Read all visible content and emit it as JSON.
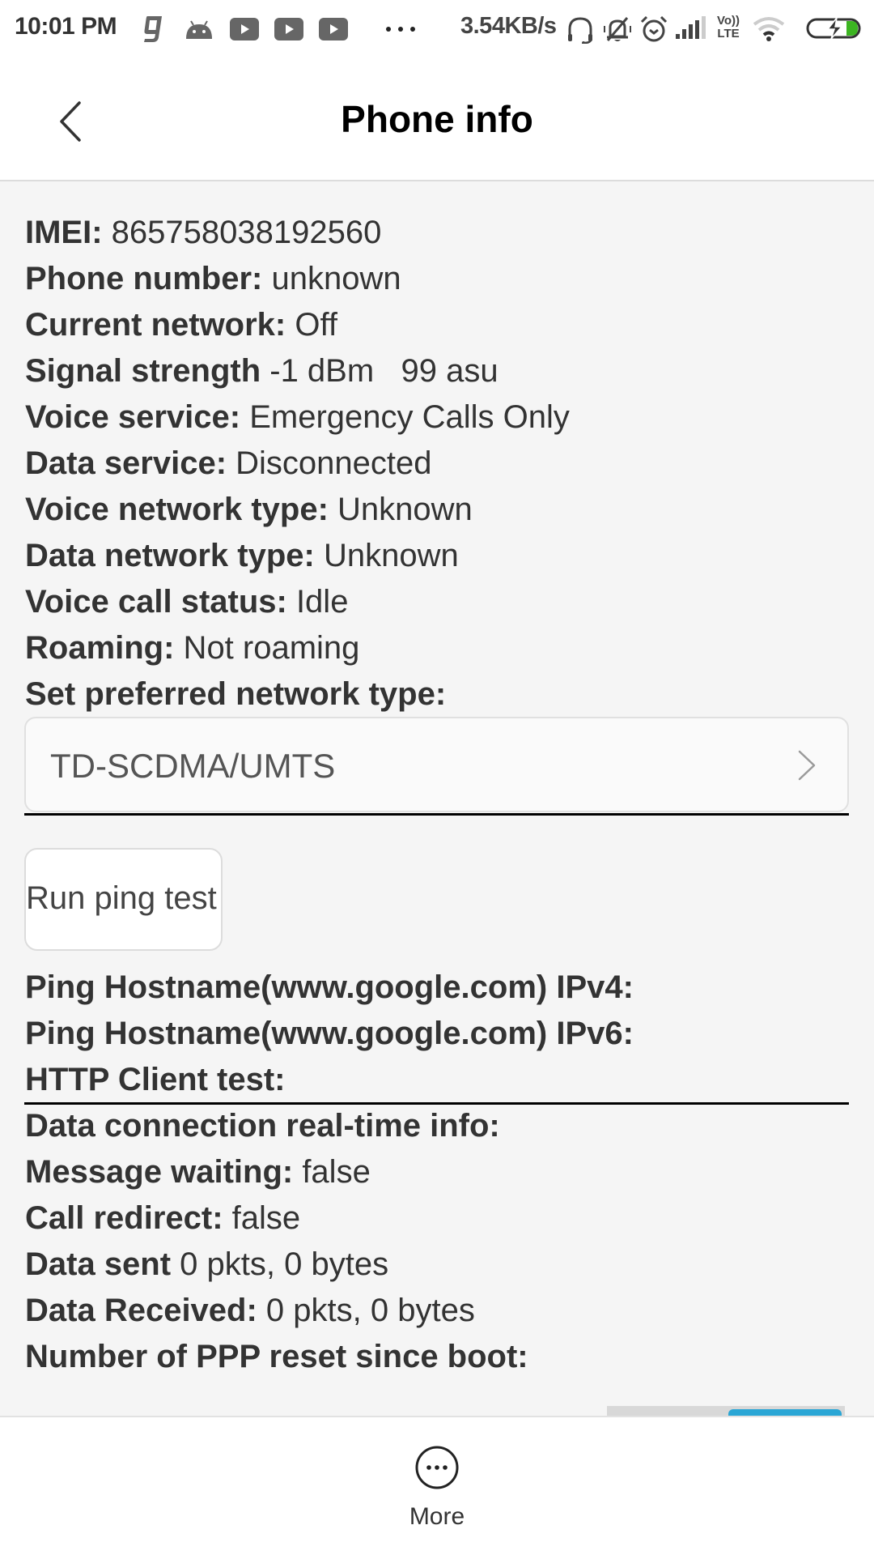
{
  "status_bar": {
    "time": "10:01 PM",
    "net_speed": "3.54KB/s",
    "left_icons": [
      "gaana-icon",
      "android-icon",
      "youtube-icon",
      "youtube-icon",
      "youtube-icon",
      "more-notifications-icon"
    ],
    "right_icons": [
      "headset-icon",
      "silent-bell-icon",
      "alarm-icon",
      "signal-icon",
      "volte-icon",
      "wifi-icon",
      "battery-charging-icon"
    ],
    "volte_text_top": "Vo))",
    "volte_text_bottom": "LTE",
    "battery_color": "#3cb521"
  },
  "header": {
    "title": "Phone info",
    "back_icon": "chevron-left-icon"
  },
  "info": [
    {
      "label": "IMEI:",
      "value": " 865758038192560"
    },
    {
      "label": "Phone number:",
      "value": " unknown"
    },
    {
      "label": "Current network:",
      "value": " Off"
    },
    {
      "label": "Signal strength",
      "value": " -1 dBm   99 asu"
    },
    {
      "label": "Voice service:",
      "value": " Emergency Calls Only"
    },
    {
      "label": "Data service:",
      "value": " Disconnected"
    },
    {
      "label": "Voice network type:",
      "value": " Unknown"
    },
    {
      "label": "Data network type:",
      "value": " Unknown"
    },
    {
      "label": "Voice call status:",
      "value": " Idle"
    },
    {
      "label": "Roaming:",
      "value": " Not roaming"
    },
    {
      "label": "Set preferred network type:",
      "value": ""
    }
  ],
  "preferred_network": {
    "selected": "TD-SCDMA/UMTS",
    "chevron_icon": "chevron-right-icon"
  },
  "ping_button": {
    "label": "Run ping test"
  },
  "ping_results": [
    {
      "label": "Ping Hostname(www.google.com) IPv4:",
      "value": ""
    },
    {
      "label": "Ping Hostname(www.google.com) IPv6:",
      "value": ""
    },
    {
      "label": "HTTP Client test:",
      "value": ""
    }
  ],
  "data_info": [
    {
      "label": "Data connection real-time info:",
      "value": ""
    },
    {
      "label": "Message waiting:",
      "value": " false"
    },
    {
      "label": "Call redirect:",
      "value": " false"
    },
    {
      "label": "Data sent",
      "value": " 0 pkts, 0 bytes"
    },
    {
      "label": "Data Received:",
      "value": " 0 pkts, 0 bytes"
    },
    {
      "label": "Number of PPP reset since boot:",
      "value": ""
    }
  ],
  "bottom_bar": {
    "more_label": "More",
    "more_icon": "more-circle-icon"
  },
  "colors": {
    "accent_partial_button": "#2aa6d5"
  }
}
